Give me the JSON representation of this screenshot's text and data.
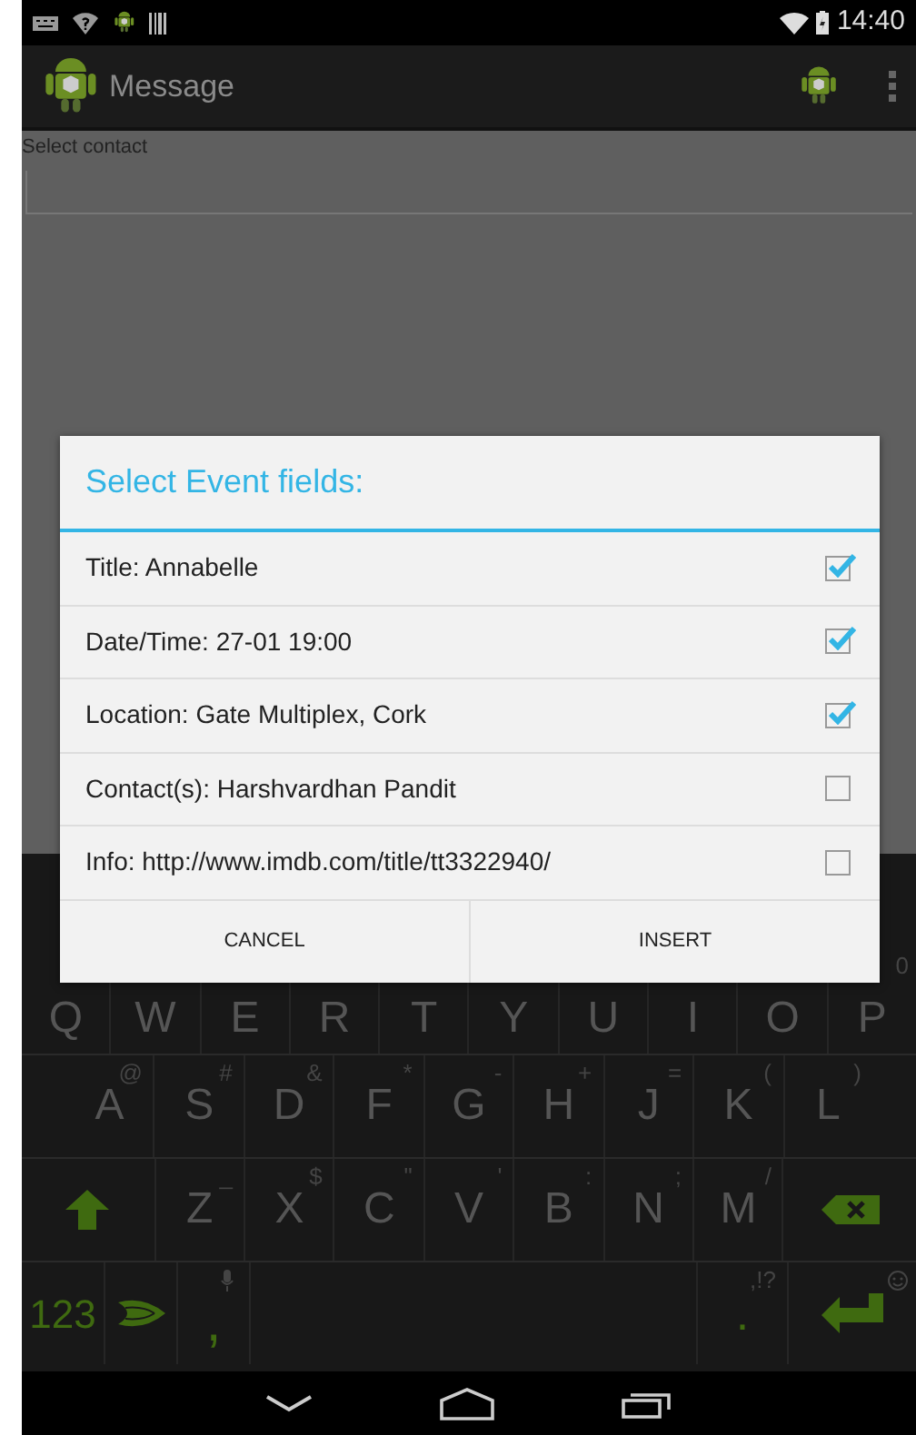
{
  "status_bar": {
    "time": "14:40"
  },
  "action_bar": {
    "title": "Message"
  },
  "form": {
    "label": "Select contact"
  },
  "dialog": {
    "title": "Select Event fields:",
    "items": [
      {
        "label": "Title: Annabelle",
        "checked": true
      },
      {
        "label": "Date/Time: 27-01 19:00",
        "checked": true
      },
      {
        "label": "Location: Gate Multiplex, Cork",
        "checked": true
      },
      {
        "label": "Contact(s): Harshvardhan Pandit",
        "checked": false
      },
      {
        "label": "Info: http://www.imdb.com/title/tt3322940/",
        "checked": false
      }
    ],
    "buttons": [
      "CANCEL",
      "INSERT"
    ]
  },
  "keyboard": {
    "rows": [
      {
        "keys": [
          {
            "kind": "letter",
            "label": "Q"
          },
          {
            "kind": "letter",
            "label": "W"
          },
          {
            "kind": "letter",
            "label": "E"
          },
          {
            "kind": "letter",
            "label": "R"
          },
          {
            "kind": "letter",
            "label": "T"
          },
          {
            "kind": "letter",
            "label": "Y"
          },
          {
            "kind": "letter",
            "label": "U"
          },
          {
            "kind": "letter",
            "label": "I"
          },
          {
            "kind": "letter",
            "label": "O"
          },
          {
            "kind": "letter",
            "label": "P",
            "hint": "0"
          }
        ]
      },
      {
        "keys": [
          {
            "kind": "letter",
            "label": "A",
            "hint": "@"
          },
          {
            "kind": "letter",
            "label": "S",
            "hint": "#"
          },
          {
            "kind": "letter",
            "label": "D",
            "hint": "&"
          },
          {
            "kind": "letter",
            "label": "F",
            "hint": "*"
          },
          {
            "kind": "letter",
            "label": "G",
            "hint": "-"
          },
          {
            "kind": "letter",
            "label": "H",
            "hint": "+"
          },
          {
            "kind": "letter",
            "label": "J",
            "hint": "="
          },
          {
            "kind": "letter",
            "label": "K",
            "hint": "("
          },
          {
            "kind": "letter",
            "label": "L",
            "hint": ")"
          }
        ]
      },
      {
        "keys": [
          {
            "kind": "shift"
          },
          {
            "kind": "letter",
            "label": "Z",
            "hint": "_"
          },
          {
            "kind": "letter",
            "label": "X",
            "hint": "$"
          },
          {
            "kind": "letter",
            "label": "C",
            "hint": "\""
          },
          {
            "kind": "letter",
            "label": "V",
            "hint": "'"
          },
          {
            "kind": "letter",
            "label": "B",
            "hint": ":"
          },
          {
            "kind": "letter",
            "label": "N",
            "hint": ";"
          },
          {
            "kind": "letter",
            "label": "M",
            "hint": "/"
          },
          {
            "kind": "backspace"
          }
        ]
      },
      {
        "keys": [
          {
            "kind": "symbols",
            "label": "123"
          },
          {
            "kind": "swype"
          },
          {
            "kind": "comma",
            "label": ","
          },
          {
            "kind": "space"
          },
          {
            "kind": "period",
            "label": ".",
            "hint": ",!?"
          },
          {
            "kind": "enter"
          }
        ]
      }
    ]
  }
}
